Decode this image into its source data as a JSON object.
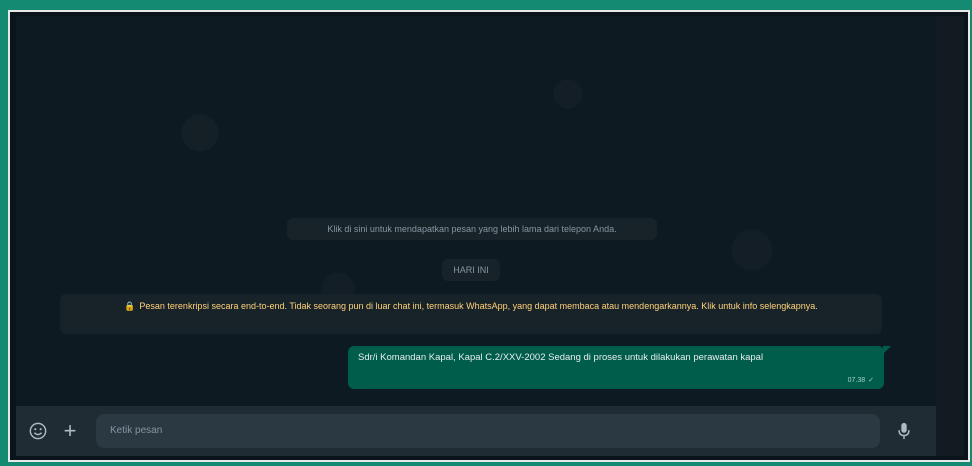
{
  "chat": {
    "load_older_notice": "Klik di sini untuk mendapatkan pesan yang lebih lama dari telepon Anda.",
    "date_divider": "HARI INI",
    "encryption_notice": "Pesan terenkripsi secara end-to-end. Tidak seorang pun di luar chat ini, termasuk WhatsApp, yang dapat membaca atau mendengarkannya. Klik untuk info selengkapnya.",
    "messages": [
      {
        "text": "Sdr/i Komandan Kapal, Kapal C.2/XXV-2002 Sedang di proses untuk dilakukan perawatan kapal",
        "time": "07.38",
        "status_icon": "single-check-icon"
      }
    ]
  },
  "composer": {
    "placeholder": "Ketik pesan",
    "emoji_icon": "emoji-icon",
    "attach_icon": "plus-icon",
    "mic_icon": "mic-icon"
  },
  "colors": {
    "outer_frame": "#148a72",
    "chat_background": "#0e1a21",
    "outgoing_bubble": "#005c4b",
    "system_note": "#182229",
    "encryption_text": "#ffd279",
    "composer_bar": "#202c33"
  }
}
